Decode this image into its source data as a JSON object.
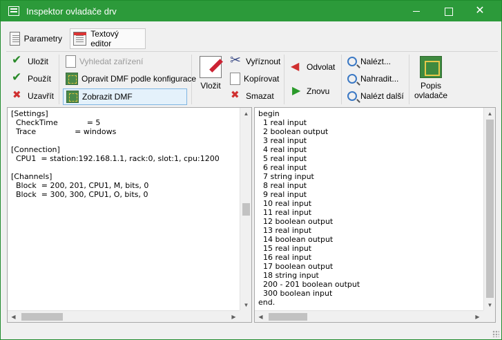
{
  "window": {
    "title": "Inspektor ovladače drv"
  },
  "tabs": [
    {
      "label": "Parametry"
    },
    {
      "label": "Textový editor"
    }
  ],
  "ribbon": {
    "save": "Uložit",
    "apply": "Použít",
    "close": "Uzavřít",
    "find_devices": "Vyhledat zařízení",
    "fix_dmf": "Opravit DMF podle konfigurace",
    "show_dmf": "Zobrazit DMF",
    "paste": "Vložit",
    "cut": "Vyříznout",
    "copy": "Kopírovat",
    "delete": "Smazat",
    "undo": "Odvolat",
    "redo": "Znovu",
    "find": "Nalézt...",
    "replace": "Nahradit...",
    "find_next": "Nalézt další",
    "driver_desc_line1": "Popis",
    "driver_desc_line2": "ovladače"
  },
  "left_editor": {
    "lines": [
      "[Settings]",
      "  CheckTime            = 5",
      "  Trace                = windows",
      "",
      "[Connection]",
      "  CPU1  = station:192.168.1.1, rack:0, slot:1, cpu:1200",
      "",
      "[Channels]",
      "  Block  = 200, 201, CPU1, M, bits, 0",
      "  Block  = 300, 300, CPU1, O, bits, 0"
    ]
  },
  "right_editor": {
    "lines": [
      "begin",
      "  1 real input",
      "  2 boolean output",
      "  3 real input",
      "  4 real input",
      "  5 real input",
      "  6 real input",
      "  7 string input",
      "  8 real input",
      "  9 real input",
      "  10 real input",
      "  11 real input",
      "  12 boolean output",
      "  13 real input",
      "  14 boolean output",
      "  15 real input",
      "  16 real input",
      "  17 boolean output",
      "  18 string input",
      "  200 - 201 boolean output",
      "  300 boolean input",
      "end."
    ]
  },
  "icons": {
    "app": "app-window-icon",
    "parametry": "parameters-icon",
    "editor": "text-editor-icon"
  },
  "colors": {
    "titlebar": "#2c9a3a",
    "active_tab_border": "#c8c8c8",
    "active_button": "#e4f1fb"
  }
}
